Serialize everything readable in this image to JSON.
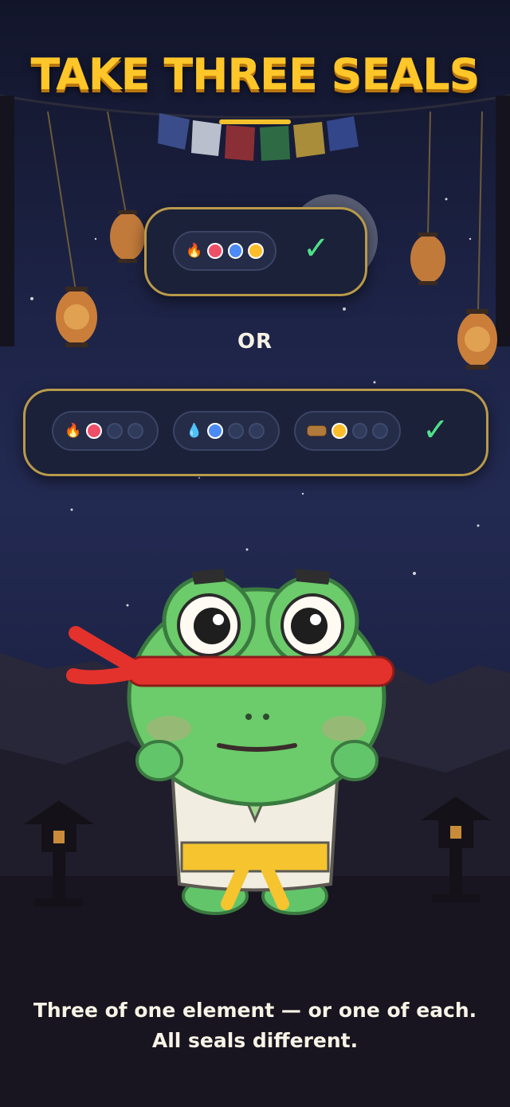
{
  "title": "TAKE THREE SEALS",
  "separator": "OR",
  "option_same": {
    "element_icon": "fire-icon",
    "seals": [
      "red",
      "blue",
      "yellow"
    ],
    "check_icon": "check-icon"
  },
  "option_each": {
    "pills": [
      {
        "element_icon": "fire-icon",
        "seals": [
          "red",
          "empty",
          "empty"
        ]
      },
      {
        "element_icon": "water-drop-icon",
        "seals": [
          "blue",
          "empty",
          "empty"
        ]
      },
      {
        "element_icon": "wood-log-icon",
        "seals": [
          "yellow",
          "empty",
          "empty"
        ]
      }
    ],
    "check_icon": "check-icon"
  },
  "colors": {
    "title": "#ffc629",
    "panel_border": "#b99a4b",
    "check": "#4fe08a",
    "seal_red": "#ee4f68",
    "seal_blue": "#4c8af5",
    "seal_yellow": "#fbbd2a"
  },
  "caption_line1": "Three of one element — or one of each.",
  "caption_line2": "All seals different."
}
